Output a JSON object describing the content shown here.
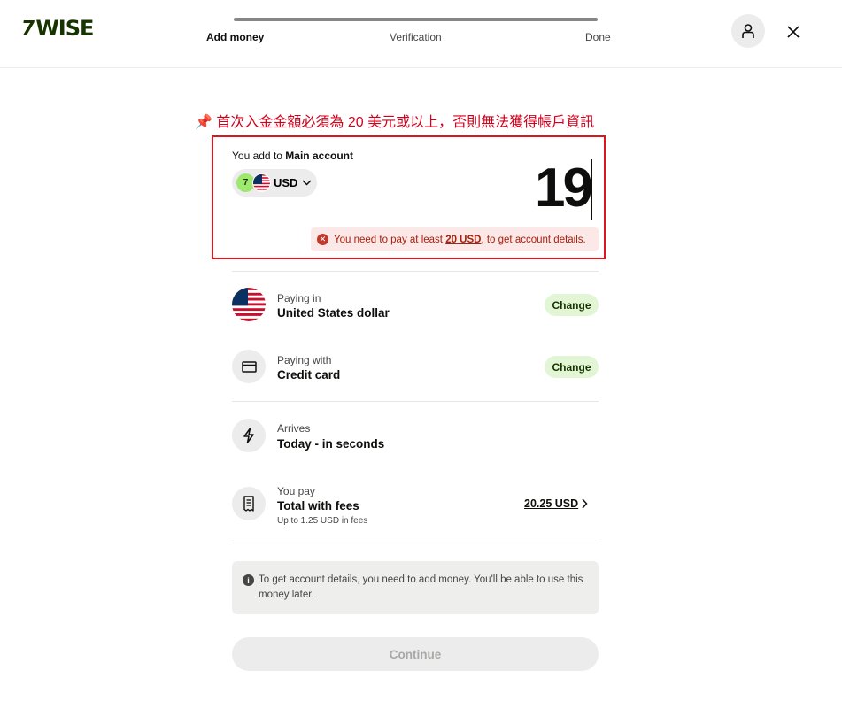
{
  "header": {
    "logo_mark": "7",
    "logo_text": "WISE",
    "steps": [
      {
        "label": "Add money",
        "active": true
      },
      {
        "label": "Verification",
        "active": false
      },
      {
        "label": "Done",
        "active": false
      }
    ],
    "profile_icon": "person-icon",
    "close_icon": "close-icon"
  },
  "annotation": {
    "icon": "📌",
    "text": "首次入金金額必須為 20 美元或以上，否則無法獲得帳戶資訊",
    "color": "#d0021b"
  },
  "amount_panel": {
    "label_prefix": "You add to",
    "label_account": "Main account",
    "currency_code": "USD",
    "amount": "19",
    "error": {
      "prefix": "You need to pay at least",
      "min_amount": "20 USD",
      "suffix": ", to get account details."
    }
  },
  "rows": {
    "paying_in": {
      "label": "Paying in",
      "value": "United States dollar",
      "action": "Change"
    },
    "paying_with": {
      "label": "Paying with",
      "value": "Credit card",
      "action": "Change"
    },
    "arrives": {
      "label": "Arrives",
      "value": "Today - in seconds"
    },
    "you_pay": {
      "label": "You pay",
      "value": "Total with fees",
      "sub": "Up to 1.25 USD in fees",
      "total": "20.25 USD"
    }
  },
  "info": {
    "text": "To get account details, you need to add money. You'll be able to use this money later."
  },
  "continue_label": "Continue",
  "colors": {
    "brand_green": "#163300",
    "accent_lime": "#9fe870",
    "error_red": "#a8200d",
    "annotation_red": "#e0151b"
  }
}
